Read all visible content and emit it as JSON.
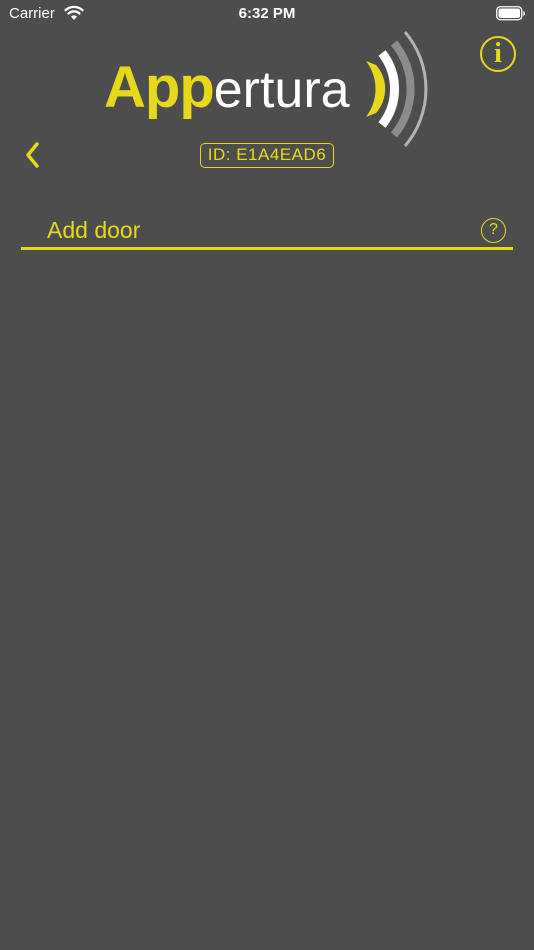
{
  "status_bar": {
    "carrier": "Carrier",
    "time": "6:32 PM",
    "wifi_icon": "wifi-icon",
    "battery_icon": "battery-full-icon"
  },
  "logo": {
    "part1": "App",
    "part2": "ertura",
    "waves_icon": "signal-waves-icon"
  },
  "header": {
    "info_label": "i",
    "back_icon": "chevron-left-icon",
    "device_id": "ID: E1A4EAD6"
  },
  "add_door": {
    "label": "Add door",
    "help_label": "?"
  },
  "colors": {
    "background": "#4d4d4d",
    "accent": "#e8d81a",
    "text": "#ffffff",
    "wave_gray": "#8c8c8c",
    "wave_light": "#b3b3b3"
  }
}
